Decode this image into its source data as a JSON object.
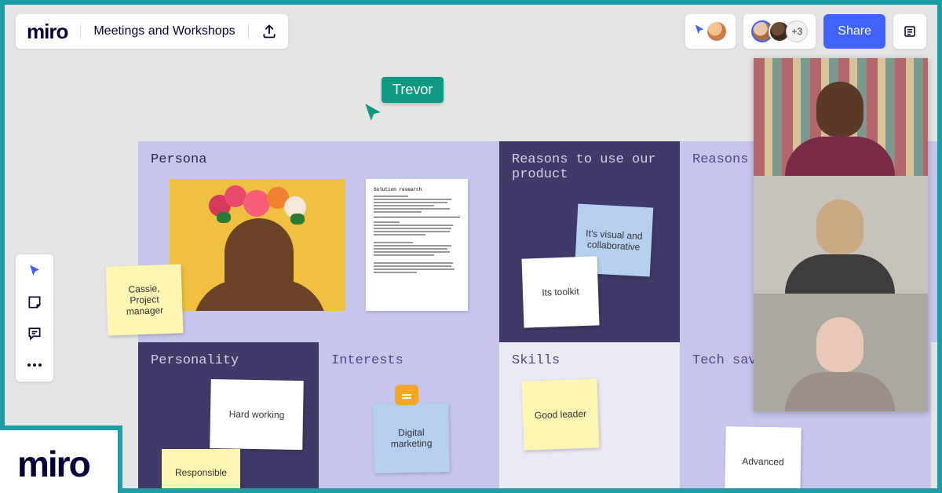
{
  "brand": "miro",
  "board_title": "Meetings and Workshops",
  "presence": {
    "extra_count": "+3"
  },
  "share_label": "Share",
  "cursor": {
    "user": "Trevor"
  },
  "sections": {
    "persona": {
      "title": "Persona"
    },
    "reasons": {
      "title": "Reasons to use our product"
    },
    "reasons2": {
      "title": "Reasons to use our product"
    },
    "personality": {
      "title": "Personality"
    },
    "interests": {
      "title": "Interests"
    },
    "skills": {
      "title": "Skills"
    },
    "tech": {
      "title": "Tech savviness"
    }
  },
  "notes": {
    "cassie": "Cassie, Project manager",
    "visual": "It's visual and collaborative",
    "toolkit": "Its toolkit",
    "hardworking": "Hard working",
    "responsible": "Responsible",
    "digital": "Digital marketing",
    "goodleader": "Good leader",
    "advanced": "Advanced"
  },
  "doc": {
    "title": "Solution research"
  }
}
